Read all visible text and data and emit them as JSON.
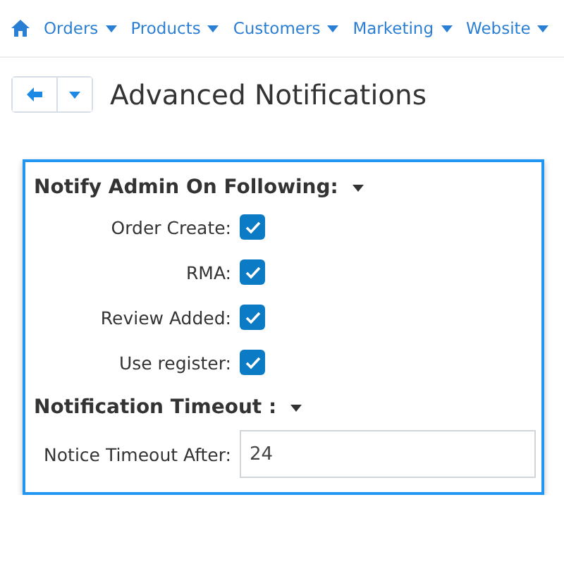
{
  "nav": {
    "items": [
      {
        "label": "Orders"
      },
      {
        "label": "Products"
      },
      {
        "label": "Customers"
      },
      {
        "label": "Marketing"
      },
      {
        "label": "Website"
      }
    ]
  },
  "page": {
    "title": "Advanced Notifications"
  },
  "sections": [
    {
      "title": "Notify Admin On Following:",
      "rows": [
        {
          "kind": "checkbox",
          "label": "Order Create:",
          "checked": true
        },
        {
          "kind": "checkbox",
          "label": "RMA:",
          "checked": true
        },
        {
          "kind": "checkbox",
          "label": "Review Added:",
          "checked": true
        },
        {
          "kind": "checkbox",
          "label": "Use register:",
          "checked": true
        }
      ]
    },
    {
      "title": "Notification Timeout :",
      "rows": [
        {
          "kind": "text",
          "label": "Notice Timeout After:",
          "value": "24"
        }
      ]
    }
  ]
}
